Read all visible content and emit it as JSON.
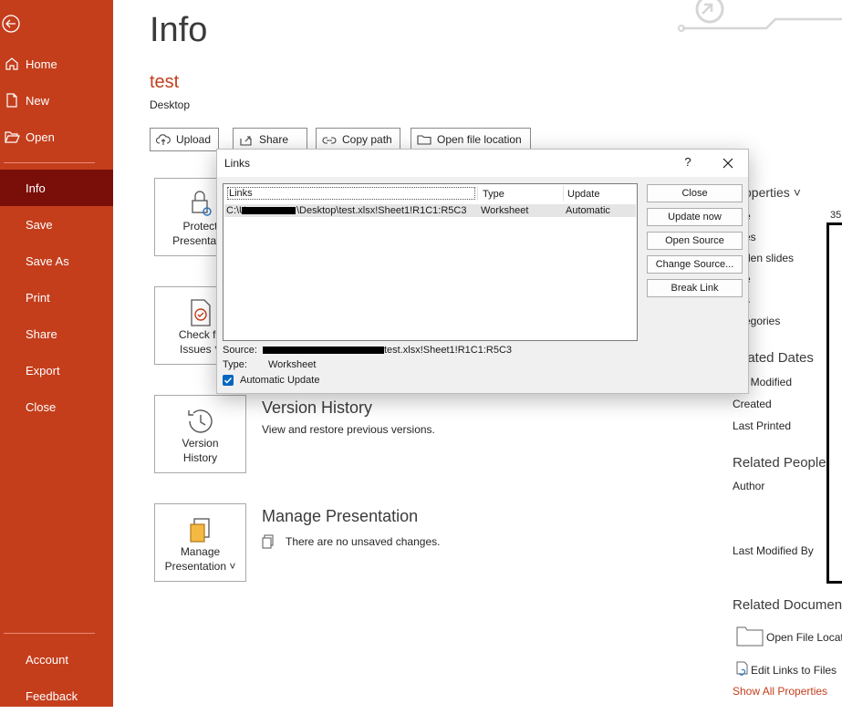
{
  "sidebar": {
    "items": [
      {
        "label": "Home"
      },
      {
        "label": "New"
      },
      {
        "label": "Open"
      },
      {
        "label": "Info"
      },
      {
        "label": "Save"
      },
      {
        "label": "Save As"
      },
      {
        "label": "Print"
      },
      {
        "label": "Share"
      },
      {
        "label": "Export"
      },
      {
        "label": "Close"
      }
    ],
    "bottom": [
      {
        "label": "Account"
      },
      {
        "label": "Feedback"
      }
    ]
  },
  "info": {
    "title": "Info",
    "file_name": "test",
    "location": "Desktop",
    "buttons": {
      "upload": "Upload",
      "share": "Share",
      "copy_path": "Copy path",
      "open_location": "Open file location"
    },
    "tiles": {
      "protect": [
        "Protect",
        "Presentatio"
      ],
      "check": [
        "Check fo",
        "Issues ˅"
      ],
      "version": [
        "Version",
        "History"
      ],
      "manage": [
        "Manage",
        "Presentation ˅"
      ]
    },
    "sections": {
      "version_title": "Version History",
      "version_desc": "View and restore previous versions.",
      "manage_title": "Manage Presentation",
      "manage_desc": "There are no unsaved changes."
    }
  },
  "properties": {
    "header": "operties ˅",
    "size_partial": "e",
    "count_value": "35",
    "slides": "es",
    "hidden_slides": "den slides",
    "title": "e",
    "tags": "s",
    "categories": "egories",
    "related_dates": "lated Dates",
    "last_modified": "t Modified",
    "created": "Created",
    "last_printed": "Last Printed",
    "related_people": "Related People",
    "author": "Author",
    "last_modified_by": "Last Modified By",
    "related_documents": "Related Documen",
    "open_file_location": "Open File Locat",
    "edit_links": "Edit Links to Files",
    "show_all": "Show All Properties"
  },
  "dialog": {
    "title": "Links",
    "help": "?",
    "columns": {
      "links": "Links",
      "type": "Type",
      "update": "Update"
    },
    "row": {
      "link_prefix": "C:\\U",
      "link_suffix": "\\Desktop\\test.xlsx!Sheet1!R1C1:R5C3",
      "type": "Worksheet",
      "update": "Automatic"
    },
    "buttons": {
      "close": "Close",
      "update_now": "Update now",
      "open_source": "Open Source",
      "change_source": "Change Source...",
      "break_link": "Break Link"
    },
    "source_label": "Source:",
    "source_value": "test.xlsx!Sheet1!R1C1:R5C3",
    "type_label": "Type:",
    "type_value": "Worksheet",
    "auto_update": "Automatic Update"
  },
  "colors": {
    "accent": "#c43e1c",
    "sidebar_active": "#7a0f0a",
    "checkbox": "#0067c0"
  }
}
